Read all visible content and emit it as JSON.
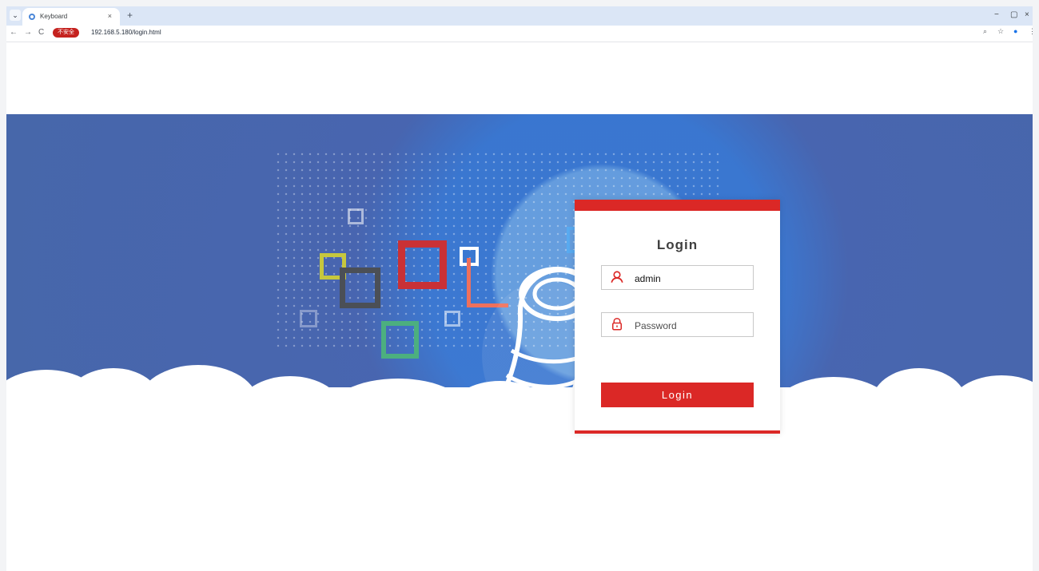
{
  "browser": {
    "tab_title": "Keyboard",
    "security_label": "不安全",
    "url": "192.168.5.180/login.html",
    "new_tab_label": "+",
    "window_controls": {
      "minimize": "−",
      "maximize": "▢",
      "close": "×"
    },
    "navigation": {
      "back": "←",
      "forward": "→",
      "reload": "C"
    },
    "toolbar_icons": [
      "zoom-icon",
      "bookmark-icon",
      "profile-icon",
      "menu-icon"
    ],
    "toolbar_symbols": {
      "zoom": "⌕",
      "bookmark": "☆",
      "profile": "●",
      "menu": "⋮"
    },
    "tab_menu": "⌄"
  },
  "login": {
    "title": "Login",
    "username_value": "admin",
    "password_placeholder": "Password",
    "button_label": "Login"
  },
  "colors": {
    "accent": "#db2826",
    "banner": "#4767aa",
    "page_background": "#ffffff"
  },
  "icons": {
    "username": "user-icon",
    "password": "lock-icon"
  }
}
